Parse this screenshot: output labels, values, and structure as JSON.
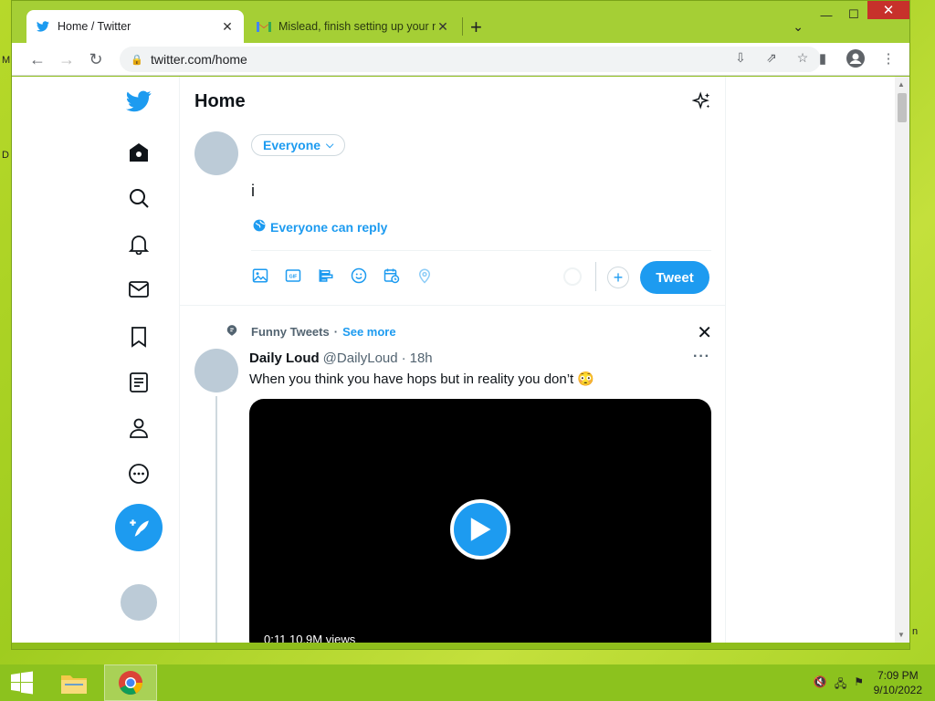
{
  "browser": {
    "tabs": [
      {
        "title": "Home / Twitter",
        "active": true
      },
      {
        "title": "Mislead, finish setting up your ne",
        "active": false
      }
    ],
    "url": "twitter.com/home"
  },
  "twitter": {
    "page_title": "Home",
    "compose": {
      "audience": "Everyone",
      "text": "i",
      "reply_setting": "Everyone can reply",
      "tweet_button": "Tweet"
    },
    "topic": {
      "name": "Funny Tweets",
      "see_more": "See more"
    },
    "tweet": {
      "name": "Daily Loud",
      "handle": "@DailyLoud",
      "sep": "·",
      "time": "18h",
      "text": "When you think you have hops but in reality you don’t 😳",
      "media_duration": "0:11",
      "media_views": "10.9M views"
    }
  },
  "taskbar": {
    "time": "7:09 PM",
    "date": "9/10/2022"
  },
  "colors": {
    "twitter_blue": "#1d9bf0",
    "desktop_green": "#a5cf35"
  }
}
